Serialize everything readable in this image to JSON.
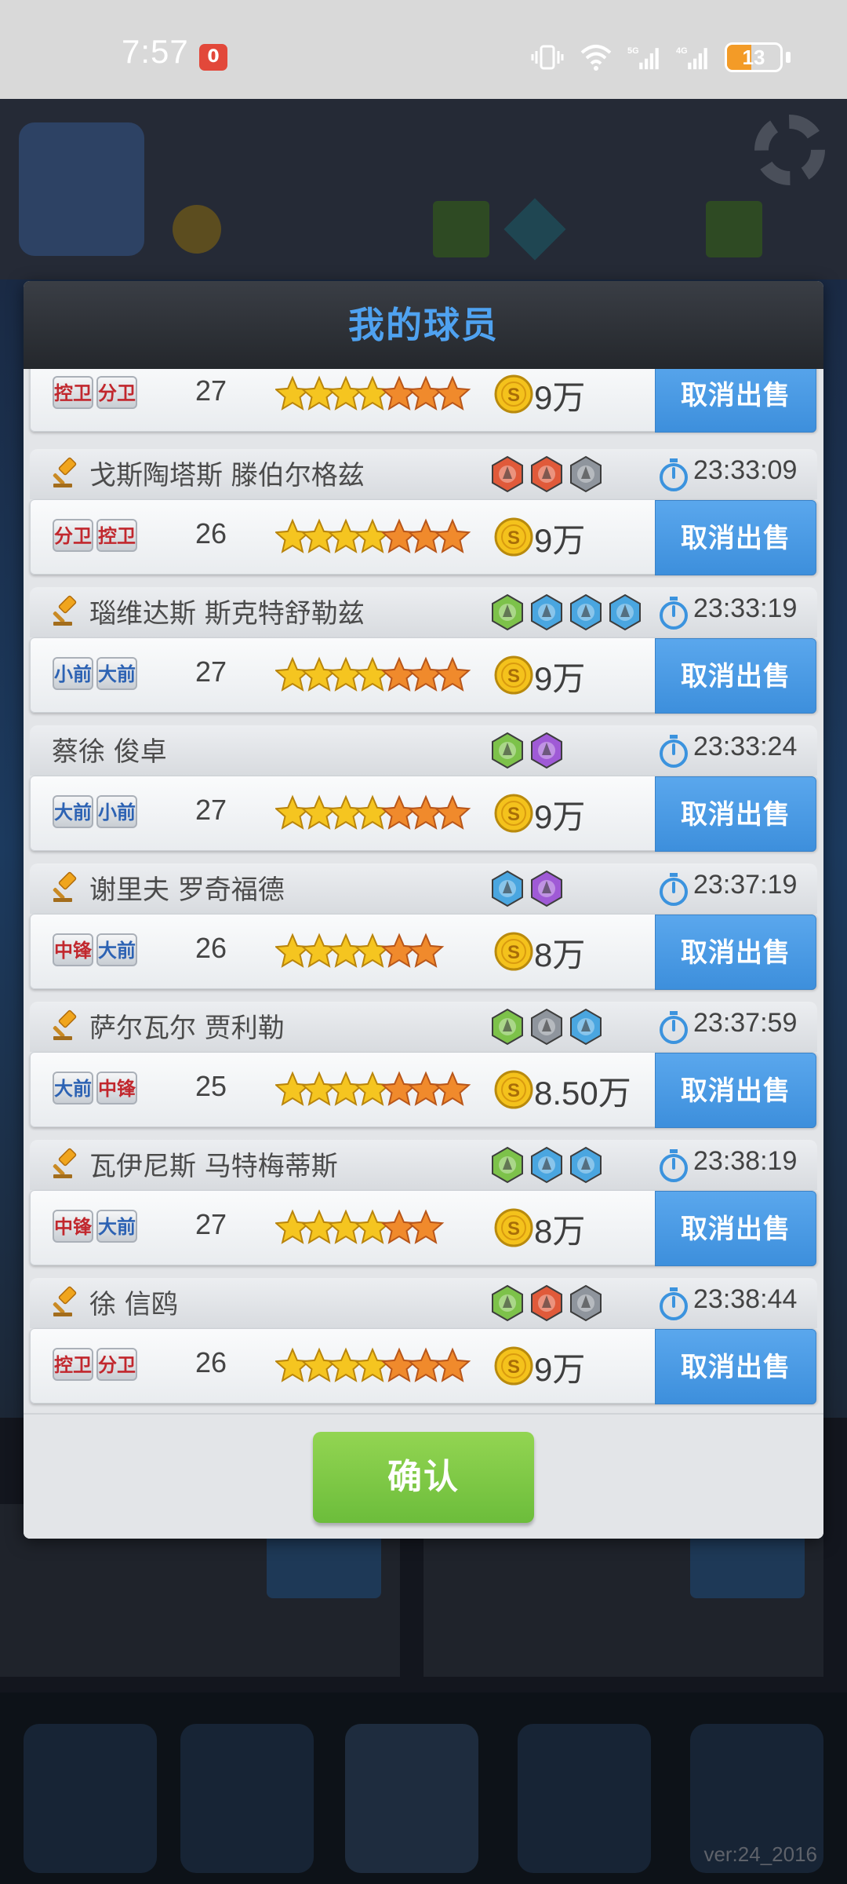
{
  "status_bar": {
    "time": "7:57",
    "notification_badge": "0",
    "battery_level": "13",
    "signal_labels": [
      "5G",
      "4G"
    ]
  },
  "background": {
    "version": "ver:24_2016"
  },
  "dialog": {
    "title": "我的球员",
    "confirm_label": "确认",
    "entries": [
      {
        "partial": true,
        "name": "",
        "gavel": false,
        "time": "",
        "badges": [],
        "positions": [
          {
            "label": "控卫",
            "color": "#c1272d"
          },
          {
            "label": "分卫",
            "color": "#c1272d"
          }
        ],
        "age": "27",
        "stars": 7,
        "price": "9万",
        "cancel_label": "取消出售"
      },
      {
        "name": "戈斯陶塔斯 滕伯尔格兹",
        "gavel": true,
        "time": "23:33:09",
        "badges": [
          "red",
          "red",
          "gray"
        ],
        "positions": [
          {
            "label": "分卫",
            "color": "#c1272d"
          },
          {
            "label": "控卫",
            "color": "#c1272d"
          }
        ],
        "age": "26",
        "stars": 7,
        "price": "9万",
        "cancel_label": "取消出售"
      },
      {
        "name": "瑙维达斯 斯克特舒勒兹",
        "gavel": true,
        "time": "23:33:19",
        "badges": [
          "green",
          "blue",
          "blue",
          "blue"
        ],
        "positions": [
          {
            "label": "小前",
            "color": "#2c62b3"
          },
          {
            "label": "大前",
            "color": "#2c62b3"
          }
        ],
        "age": "27",
        "stars": 7,
        "price": "9万",
        "cancel_label": "取消出售"
      },
      {
        "name": "蔡徐 俊卓",
        "gavel": false,
        "time": "23:33:24",
        "badges": [
          "green",
          "purple"
        ],
        "positions": [
          {
            "label": "大前",
            "color": "#2c62b3"
          },
          {
            "label": "小前",
            "color": "#2c62b3"
          }
        ],
        "age": "27",
        "stars": 7,
        "price": "9万",
        "cancel_label": "取消出售"
      },
      {
        "name": "谢里夫 罗奇福德",
        "gavel": true,
        "time": "23:37:19",
        "badges": [
          "blue",
          "purple"
        ],
        "positions": [
          {
            "label": "中锋",
            "color": "#c1272d"
          },
          {
            "label": "大前",
            "color": "#2c62b3"
          }
        ],
        "age": "26",
        "stars": 6,
        "price": "8万",
        "cancel_label": "取消出售"
      },
      {
        "name": "萨尔瓦尔 贾利勒",
        "gavel": true,
        "time": "23:37:59",
        "badges": [
          "green",
          "gray",
          "blue"
        ],
        "positions": [
          {
            "label": "大前",
            "color": "#2c62b3"
          },
          {
            "label": "中锋",
            "color": "#c1272d"
          }
        ],
        "age": "25",
        "stars": 7,
        "price": "8.50万",
        "cancel_label": "取消出售"
      },
      {
        "name": "瓦伊尼斯 马特梅蒂斯",
        "gavel": true,
        "time": "23:38:19",
        "badges": [
          "green",
          "blue",
          "blue"
        ],
        "positions": [
          {
            "label": "中锋",
            "color": "#c1272d"
          },
          {
            "label": "大前",
            "color": "#2c62b3"
          }
        ],
        "age": "27",
        "stars": 6,
        "price": "8万",
        "cancel_label": "取消出售"
      },
      {
        "name": "徐 信鸥",
        "gavel": true,
        "time": "23:38:44",
        "badges": [
          "green",
          "red",
          "gray"
        ],
        "positions": [
          {
            "label": "控卫",
            "color": "#c1272d"
          },
          {
            "label": "分卫",
            "color": "#c1272d"
          }
        ],
        "age": "26",
        "stars": 7,
        "price": "9万",
        "cancel_label": "取消出售"
      }
    ]
  },
  "colors": {
    "title_blue": "#4fa2f0",
    "cancel_blue": "#4a9be6",
    "confirm_green": "#7cc744",
    "badge_red": "#e05a3a",
    "badge_green": "#7dc24a",
    "badge_blue": "#4aa6e0",
    "badge_gray": "#8f959d",
    "badge_purple": "#9f5ad6"
  }
}
